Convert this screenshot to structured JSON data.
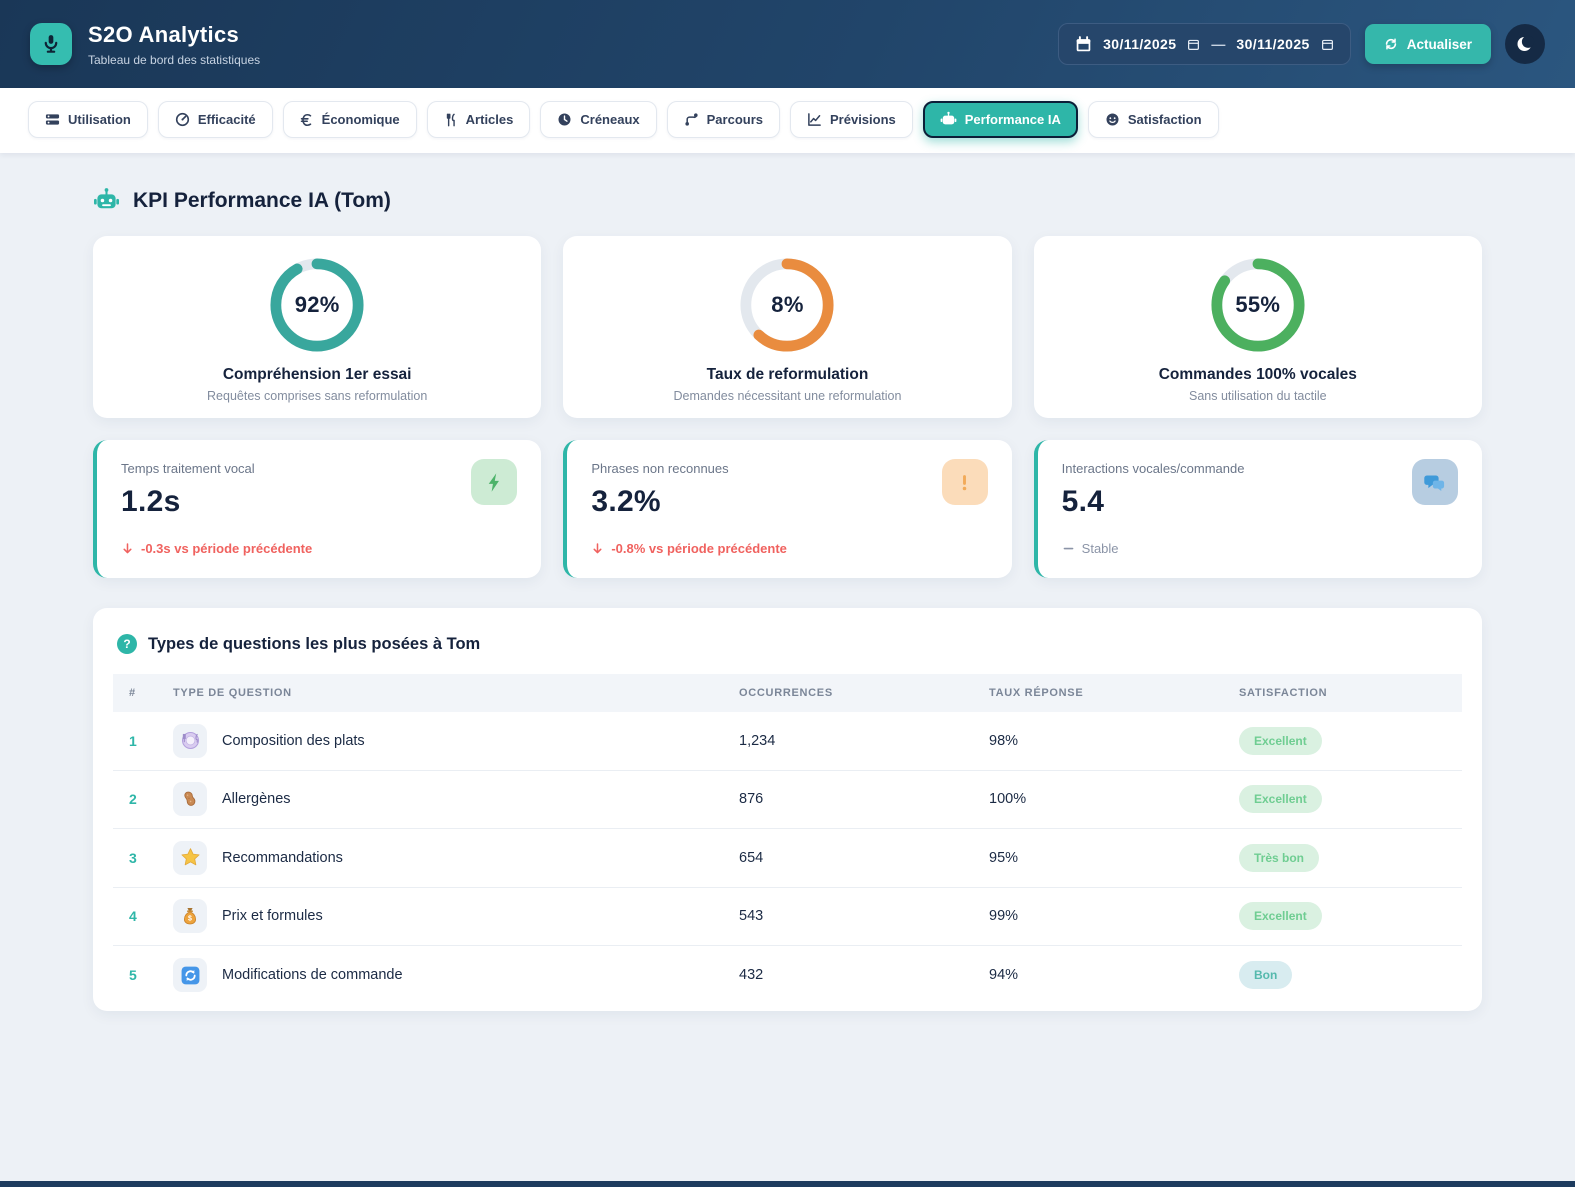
{
  "header": {
    "app_title": "S2O Analytics",
    "app_subtitle": "Tableau de bord des statistiques",
    "date_from": "30/11/2025",
    "date_to": "30/11/2025",
    "date_separator": "—",
    "refresh_label": "Actualiser",
    "brand_color": "#2eb6a8",
    "header_bg": "#21456a"
  },
  "tabs": [
    {
      "label": "Utilisation",
      "icon": "bars-icon",
      "active": false
    },
    {
      "label": "Efficacité",
      "icon": "gauge-icon",
      "active": false
    },
    {
      "label": "Économique",
      "icon": "euro-icon",
      "active": false
    },
    {
      "label": "Articles",
      "icon": "cutlery-icon",
      "active": false
    },
    {
      "label": "Créneaux",
      "icon": "clock-icon",
      "active": false
    },
    {
      "label": "Parcours",
      "icon": "route-icon",
      "active": false
    },
    {
      "label": "Prévisions",
      "icon": "trend-icon",
      "active": false
    },
    {
      "label": "Performance IA",
      "icon": "robot-icon",
      "active": true
    },
    {
      "label": "Satisfaction",
      "icon": "smiley-icon",
      "active": false
    }
  ],
  "section": {
    "title": "KPI Performance IA (Tom)",
    "icon": "robot-icon"
  },
  "chart_data": {
    "type": "donut",
    "track_color": "#e3e8ee",
    "charts": [
      {
        "title": "Compréhension 1er essai",
        "subtitle": "Requêtes comprises sans reformulation",
        "value": 92,
        "display": "92%",
        "color": "#39a79d",
        "arc_percent": 92
      },
      {
        "title": "Taux de reformulation",
        "subtitle": "Demandes nécessitant une reformulation",
        "value": 8,
        "display": "8%",
        "color": "#e98c3f",
        "arc_percent": 62
      },
      {
        "title": "Commandes 100% vocales",
        "subtitle": "Sans utilisation du tactile",
        "value": 55,
        "display": "55%",
        "color": "#4cb05f",
        "arc_percent": 85
      }
    ]
  },
  "stats": [
    {
      "label": "Temps traitement vocal",
      "value": "1.2s",
      "trend": "-0.3s vs période précédente",
      "trend_type": "down",
      "icon": "bolt-icon",
      "icon_bg": "#cdebd4",
      "icon_color": "#4db36a"
    },
    {
      "label": "Phrases non reconnues",
      "value": "3.2%",
      "trend": "-0.8% vs période précédente",
      "trend_type": "down",
      "icon": "alert-icon",
      "icon_bg": "#fbdcba",
      "icon_color": "#f2aa58"
    },
    {
      "label": "Interactions vocales/commande",
      "value": "5.4",
      "trend": "Stable",
      "trend_type": "stable",
      "icon": "chat-icon",
      "icon_bg": "#b7cde1",
      "icon_color": "#3f9ad9"
    }
  ],
  "table": {
    "title": "Types de questions les plus posées à Tom",
    "columns": [
      "#",
      "TYPE DE QUESTION",
      "OCCURRENCES",
      "TAUX RÉPONSE",
      "SATISFACTION"
    ],
    "rows": [
      {
        "rank": "1",
        "icon": "plate-icon",
        "label": "Composition des plats",
        "occurrences": "1,234",
        "taux": "98%",
        "satisfaction": "Excellent",
        "badge_style": "green"
      },
      {
        "rank": "2",
        "icon": "peanut-icon",
        "label": "Allergènes",
        "occurrences": "876",
        "taux": "100%",
        "satisfaction": "Excellent",
        "badge_style": "green"
      },
      {
        "rank": "3",
        "icon": "star-icon",
        "label": "Recommandations",
        "occurrences": "654",
        "taux": "95%",
        "satisfaction": "Très bon",
        "badge_style": "green"
      },
      {
        "rank": "4",
        "icon": "moneybag-icon",
        "label": "Prix et formules",
        "occurrences": "543",
        "taux": "99%",
        "satisfaction": "Excellent",
        "badge_style": "green"
      },
      {
        "rank": "5",
        "icon": "refresh-icon",
        "label": "Modifications de commande",
        "occurrences": "432",
        "taux": "94%",
        "satisfaction": "Bon",
        "badge_style": "teal"
      }
    ]
  }
}
